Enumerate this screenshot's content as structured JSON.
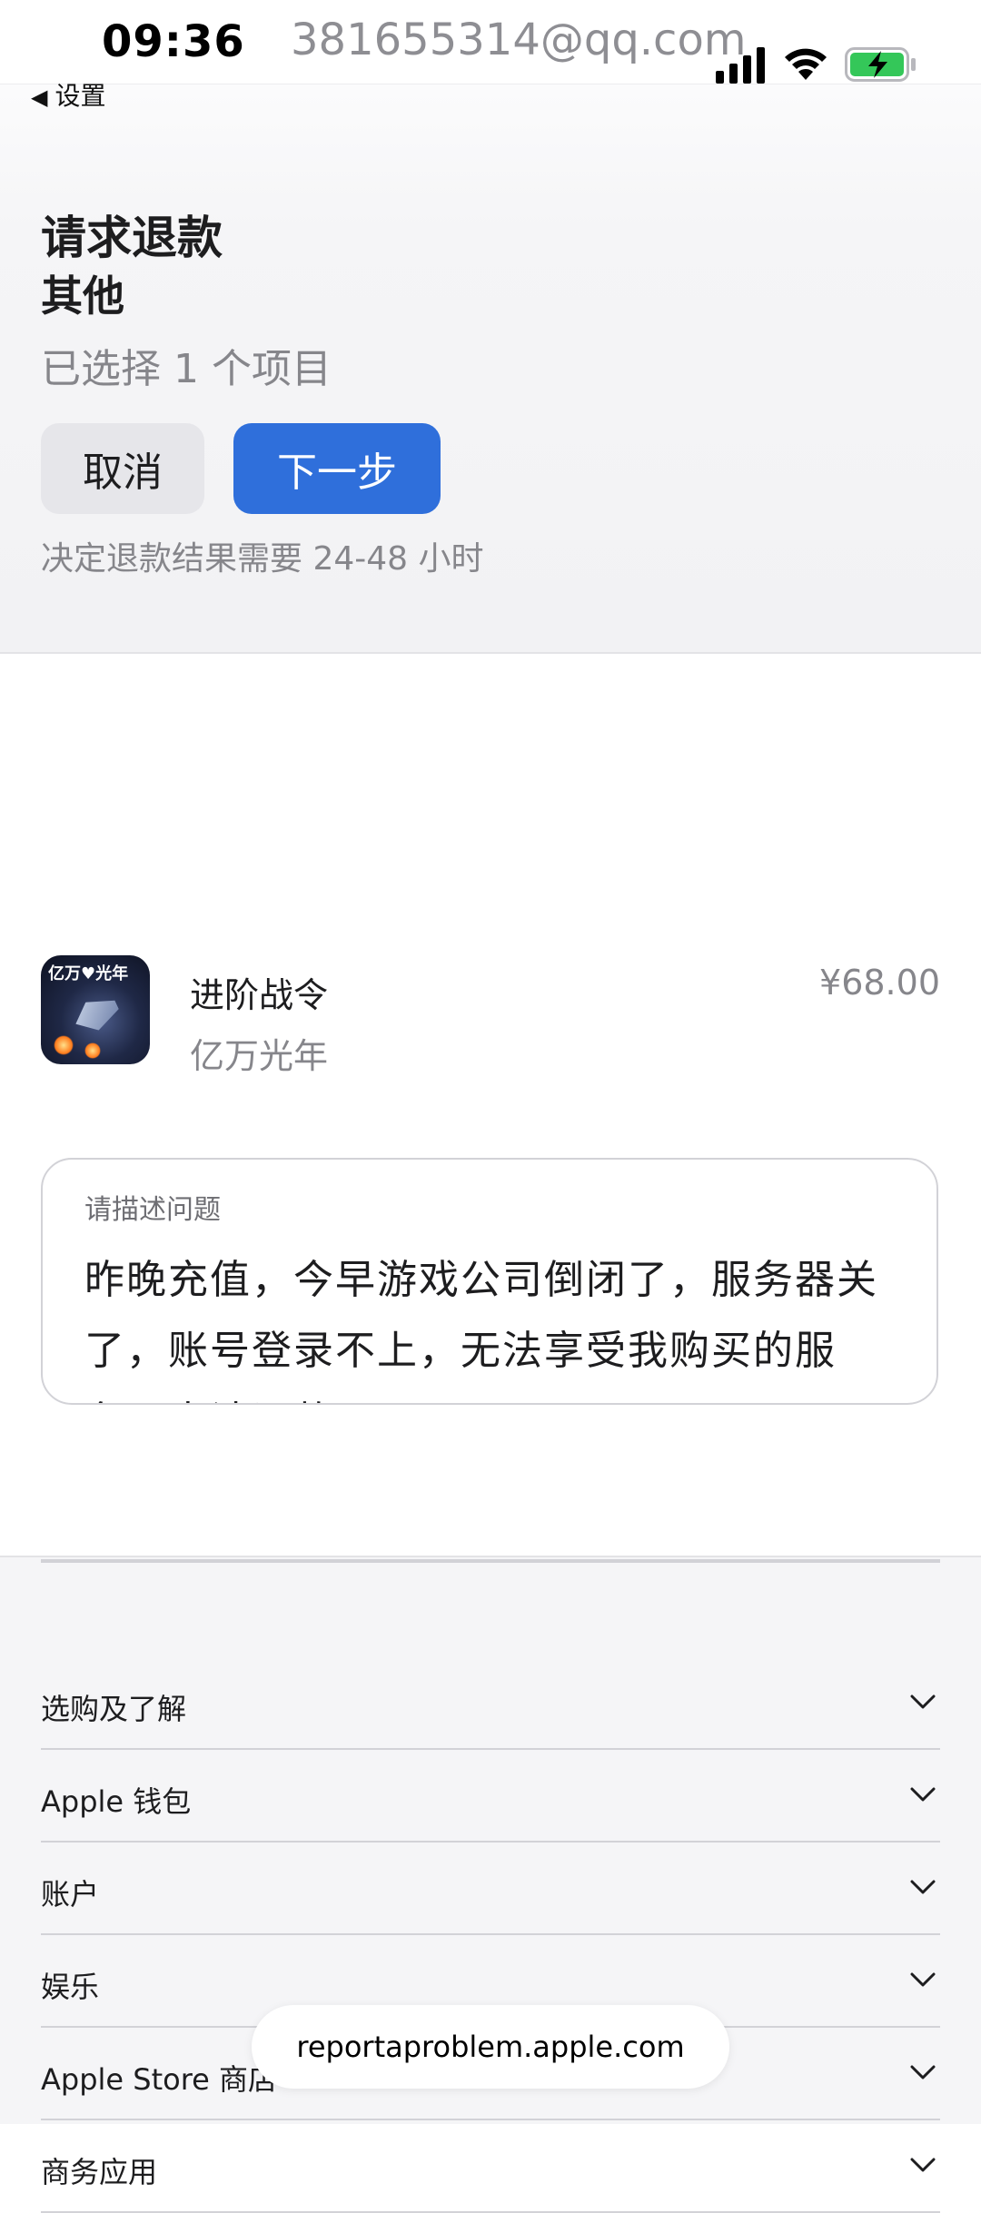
{
  "status_bar": {
    "time": "09:36",
    "account_email": "381655314@qq.com",
    "icons": [
      "cellular-signal-icon",
      "wifi-icon",
      "battery-charging-icon"
    ],
    "battery_color": "#34c759"
  },
  "nav": {
    "back_label": "设置",
    "back_glyph": "◀"
  },
  "header": {
    "title": "请求退款",
    "reason": "其他",
    "selected_count_text": "已选择 1 个项目"
  },
  "actions": {
    "cancel_label": "取消",
    "next_label": "下一步",
    "next_color": "#2f6fdb",
    "note": "决定退款结果需要 24-48 小时"
  },
  "item": {
    "name": "进阶战令",
    "app_name": "亿万光年",
    "price": "¥68.00",
    "icon_text": "亿万♥光年"
  },
  "description": {
    "label": "请描述问题",
    "text": "昨晚充值，今早游戏公司倒闭了，服务器关了，账号登录不上，无法享受我购买的服务，申请退款。"
  },
  "footer": {
    "items": [
      {
        "label": "选购及了解"
      },
      {
        "label": "Apple 钱包"
      },
      {
        "label": "账户"
      },
      {
        "label": "娱乐"
      },
      {
        "label": "Apple Store 商店"
      },
      {
        "label": "商务应用"
      }
    ]
  },
  "browser": {
    "url": "reportaproblem.apple.com"
  }
}
